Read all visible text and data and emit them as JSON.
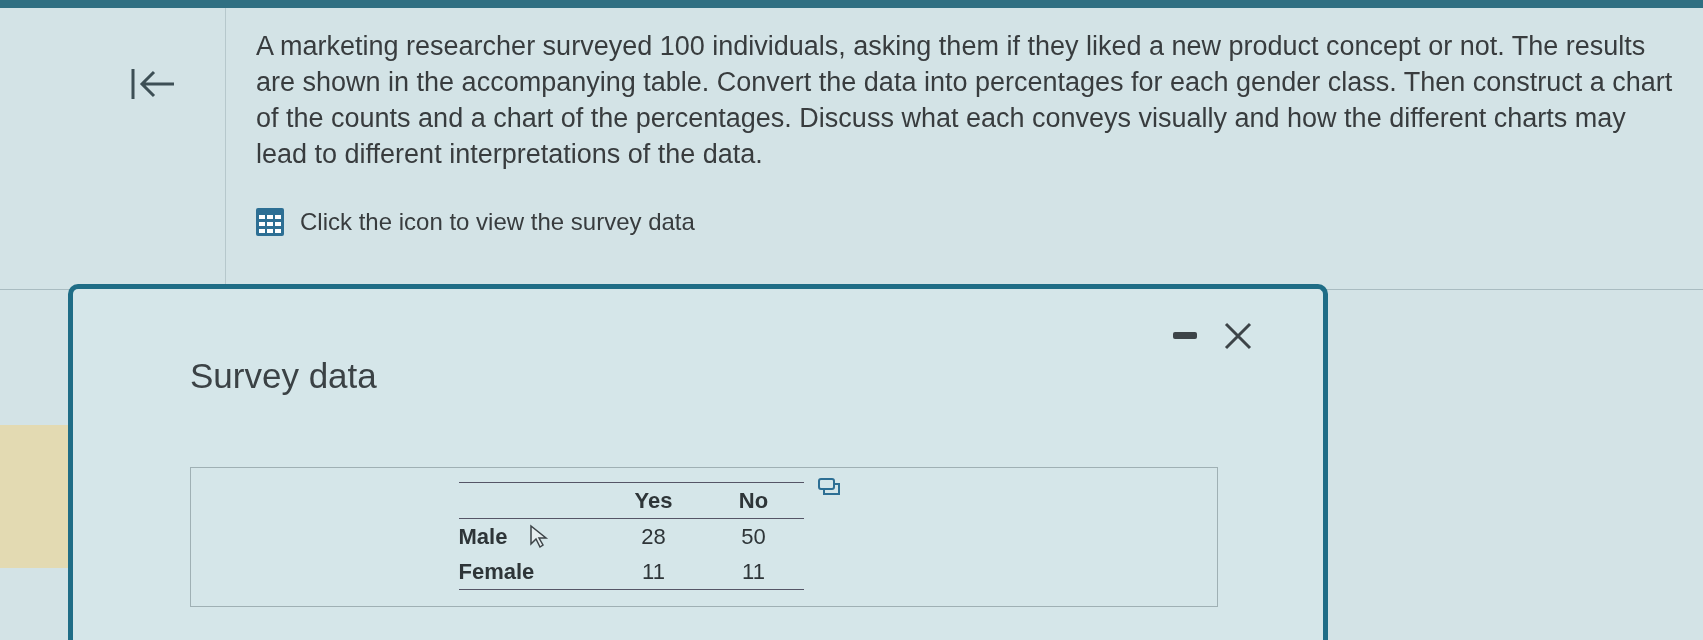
{
  "question": {
    "text": "A marketing researcher surveyed 100 individuals, asking them if they liked a new product concept or not. The results are shown in the accompanying table. Convert the data into percentages for each gender class. Then construct a chart of the counts and a chart of the percentages. Discuss what each conveys visually and how the different charts may lead to different interpretations of the data.",
    "data_link": "Click the icon to view the survey data"
  },
  "dialog": {
    "title": "Survey data",
    "table": {
      "columns": [
        "Yes",
        "No"
      ],
      "rows": [
        {
          "label": "Male",
          "values": [
            "28",
            "50"
          ]
        },
        {
          "label": "Female",
          "values": [
            "11",
            "11"
          ]
        }
      ]
    }
  }
}
